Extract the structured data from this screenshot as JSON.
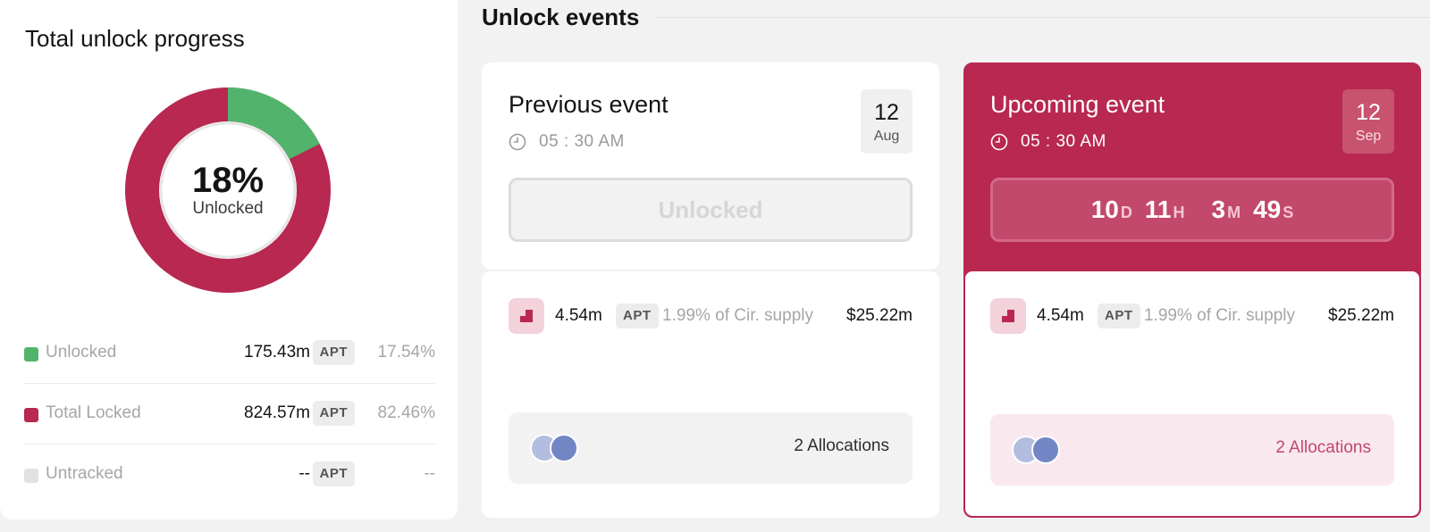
{
  "progress": {
    "title": "Total unlock progress",
    "percent_text": "18%",
    "percent_label": "Unlocked",
    "unlocked_fraction": 0.1754,
    "colors": {
      "unlocked": "#52b46c",
      "locked": "#b82851",
      "untracked": "#e2e2e2"
    },
    "legend": [
      {
        "label": "Unlocked",
        "value": "175.43m",
        "token": "APT",
        "pct": "17.54%"
      },
      {
        "label": "Total Locked",
        "value": "824.57m",
        "token": "APT",
        "pct": "82.46%"
      },
      {
        "label": "Untracked",
        "value": "--",
        "token": "APT",
        "pct": "--"
      }
    ]
  },
  "events": {
    "section_title": "Unlock events",
    "previous": {
      "title": "Previous event",
      "time": "05 : 30 AM",
      "date_day": "12",
      "date_month": "Aug",
      "status": "Unlocked",
      "amount": "4.54m",
      "token": "APT",
      "supply": "1.99% of Cir. supply",
      "usd": "$25.22m",
      "allocations": "2 Allocations"
    },
    "upcoming": {
      "title": "Upcoming event",
      "time": "05 : 30 AM",
      "date_day": "12",
      "date_month": "Sep",
      "countdown": {
        "days": "10",
        "days_unit": "D",
        "hours": "11",
        "hours_unit": "H",
        "minutes": "3",
        "minutes_unit": "M",
        "seconds": "49",
        "seconds_unit": "S"
      },
      "amount": "4.54m",
      "token": "APT",
      "supply": "1.99% of Cir. supply",
      "usd": "$25.22m",
      "allocations": "2 Allocations"
    }
  }
}
